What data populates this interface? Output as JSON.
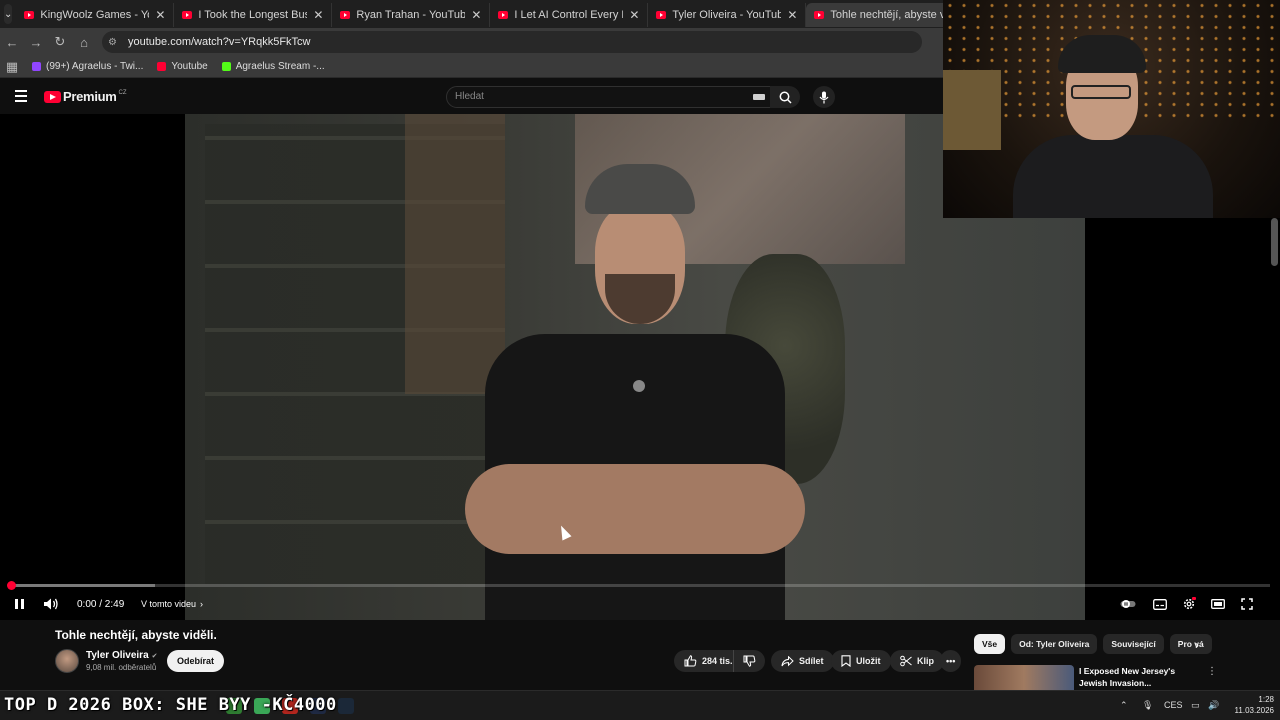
{
  "browser": {
    "tabs": [
      {
        "label": "KingWoolz Games - YouTube",
        "active": false
      },
      {
        "label": "I Took the Longest Bus Ride in A",
        "active": false
      },
      {
        "label": "Ryan Trahan - YouTube",
        "active": false
      },
      {
        "label": "I Let AI Control Every Meal for 7",
        "active": false
      },
      {
        "label": "Tyler Oliveira - YouTube",
        "active": false
      },
      {
        "label": "Tohle nechtějí, abyste viděli.",
        "active": true
      }
    ],
    "url": "youtube.com/watch?v=YRqkk5FkTcw",
    "bookmarks": [
      {
        "label": "(99+) Agraelus - Twi...",
        "color": "#9146ff"
      },
      {
        "label": "Youtube",
        "color": "#ff0033"
      },
      {
        "label": "Agraelus Stream -...",
        "color": "#53fc18"
      }
    ]
  },
  "youtube": {
    "brand": "Premium",
    "country": "CZ",
    "search_placeholder": "Hledat"
  },
  "player": {
    "time": "0:00 / 2:49",
    "chapters_label": "V tomto videu",
    "progress_played": 0.0,
    "progress_loaded": 0.115,
    "accent": "#ff0033"
  },
  "video": {
    "title": "Tohle nechtějí, abyste viděli.",
    "channel": "Tyler Oliveira",
    "subscribers": "9,08 mil. odběratelů",
    "subscribe_label": "Odebírat",
    "likes": "284 tis.",
    "share_label": "Sdílet",
    "save_label": "Uložit",
    "clip_label": "Klip"
  },
  "sidebar": {
    "chips": [
      {
        "label": "Vše",
        "selected": true
      },
      {
        "label": "Od: Tyler Oliveira",
        "selected": false
      },
      {
        "label": "Související",
        "selected": false
      },
      {
        "label": "Pro vá",
        "selected": false
      }
    ],
    "rec_title": "I Exposed New Jersey's Jewish Invasion..."
  },
  "taskbar": {
    "ticker": "TOP D 2026 BOX: SHE  BYY -KČ4000",
    "lang": "CES",
    "time": "1:28",
    "date": "11.03.2026"
  }
}
